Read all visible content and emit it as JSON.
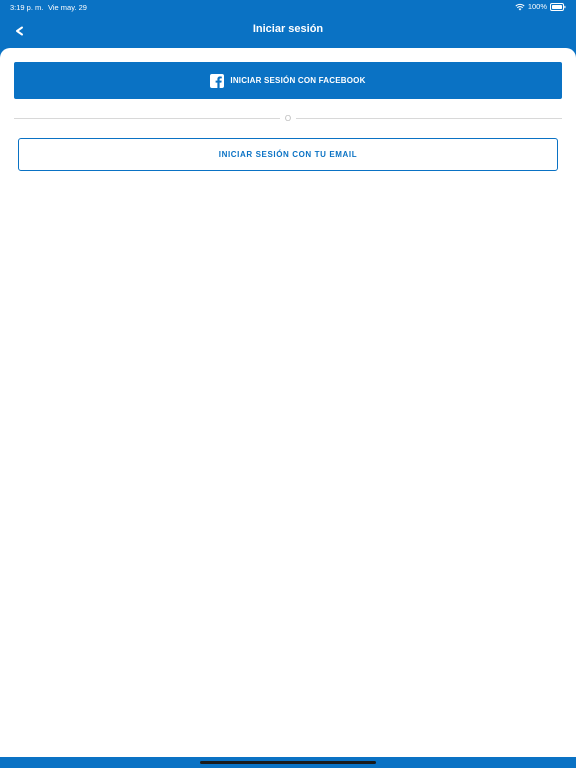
{
  "status_bar": {
    "time": "3:19 p. m.",
    "date": "Vie may. 29",
    "battery": "100%",
    "wifi_icon": "wifi-icon",
    "battery_icon": "battery-icon"
  },
  "nav": {
    "back_label": "<",
    "title": "Iniciar sesión"
  },
  "facebook_button": {
    "icon": "facebook-icon",
    "label": "INICIAR SESIÓN CON FACEBOOK"
  },
  "divider": {
    "text": "O"
  },
  "email_button": {
    "label": "INICIAR SESIÓN CON TU EMAIL"
  },
  "colors": {
    "brand": "#0A72C4",
    "background": "#FFFFFF",
    "divider": "#D8D8D8"
  }
}
